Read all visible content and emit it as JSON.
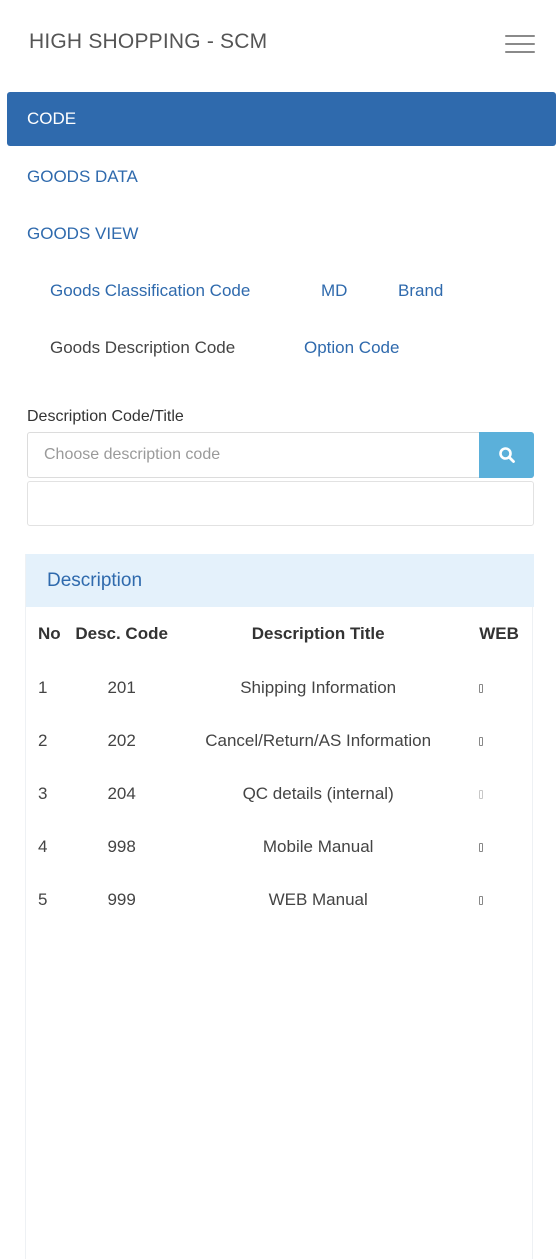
{
  "header": {
    "title": "HIGH SHOPPING - SCM",
    "menu_icon": "hamburger-menu-icon"
  },
  "nav": {
    "code": "CODE",
    "goods_data": "GOODS DATA",
    "goods_view": "GOODS VIEW"
  },
  "subnav": {
    "items": [
      {
        "label": "Goods Classification Code",
        "active": false
      },
      {
        "label": "MD",
        "active": false
      },
      {
        "label": "Brand",
        "active": false
      },
      {
        "label": "Goods Description Code",
        "active": true
      },
      {
        "label": "Option Code",
        "active": false
      }
    ]
  },
  "search": {
    "label": "Description Code/Title",
    "placeholder": "Choose description code",
    "value": "",
    "button_icon": "search-icon"
  },
  "panel": {
    "heading": "Description",
    "columns": [
      "No",
      "Desc. Code",
      "Description Title",
      "WEB"
    ],
    "rows": [
      {
        "no": "1",
        "code": "201",
        "title": "Shipping Information"
      },
      {
        "no": "2",
        "code": "202",
        "title": "Cancel/Return/AS Information"
      },
      {
        "no": "3",
        "code": "204",
        "title": "QC details (internal)"
      },
      {
        "no": "4",
        "code": "998",
        "title": "Mobile Manual"
      },
      {
        "no": "5",
        "code": "999",
        "title": "WEB Manual"
      }
    ]
  },
  "colors": {
    "primary": "#2f6aad",
    "search_button": "#5bb0da",
    "panel_heading_bg": "#e4f1fb"
  }
}
